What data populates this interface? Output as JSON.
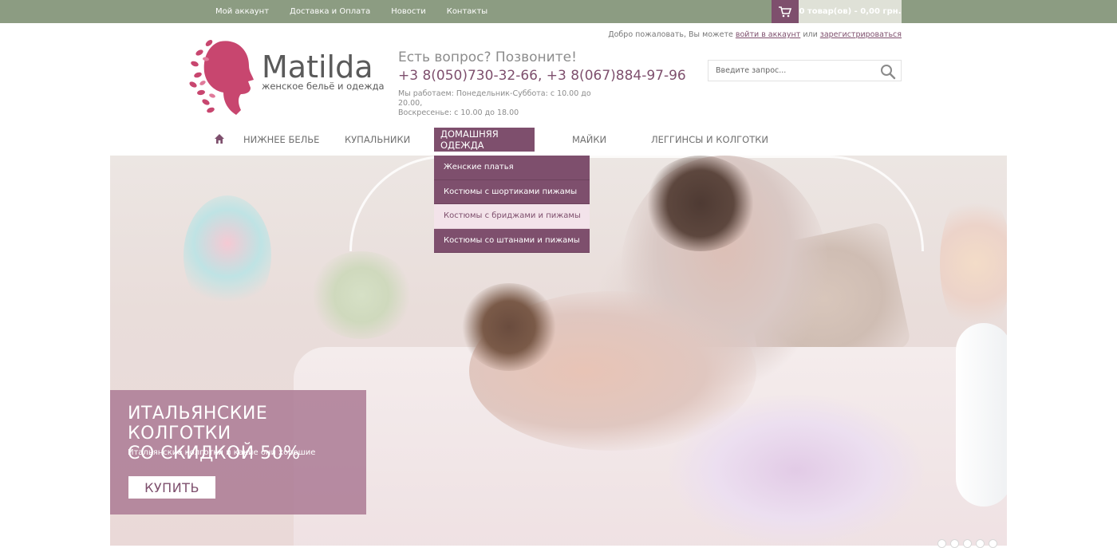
{
  "topbar": {
    "links": [
      "Мой аккаунт",
      "Доставка и Оплата",
      "Новости",
      "Контакты"
    ],
    "cart_text": "0 товар(ов) - 0,00 грн.",
    "cart_icon": "cart-icon"
  },
  "header": {
    "welcome_prefix": "Добро пожаловать, Вы можете",
    "login_link": "войти в аккаунт",
    "or_text": "или",
    "register_link": "зарегистрироваться",
    "logo_title": "Matilda",
    "logo_subtitle": "женское бельё и одежда",
    "ask": "Есть вопрос? Позвоните!",
    "phones": "+3 8(050)730-32-66, +3 8(067)884-97-96",
    "hours_line1": "Мы работаем: Понедельник-Суббота: с 10.00 до 20.00,",
    "hours_line2": "Воскресенье: с 10.00 до 18.00",
    "search_placeholder": "Введите запрос..."
  },
  "nav": {
    "items": [
      "НИЖНЕЕ БЕЛЬЕ",
      "КУПАЛЬНИКИ",
      "ДОМАШНЯЯ ОДЕЖДА",
      "МАЙКИ",
      "ЛЕГГИНСЫ И КОЛГОТКИ"
    ],
    "active_item": "ДОМАШНЯЯ ОДЕЖДА",
    "dropdown": [
      "Женские платья",
      "Костюмы с шортиками пижамы",
      "Костюмы с бриджами и пижамы",
      "Костюмы со штанами и пижамы"
    ],
    "dropdown_hover": "Костюмы с бриджами и пижамы"
  },
  "slider": {
    "promo_title_line1": "ИТАЛЬЯНСКИЕ КОЛГОТКИ",
    "promo_title_line2": "СО СКИДКОЙ 50%",
    "promo_subtitle": "Итальянские колготки и какие они хорошие",
    "promo_button": "КУПИТЬ",
    "dots_count": 5
  },
  "colors": {
    "topbar": "#8c9c82",
    "accent": "#7e4f6d",
    "promo_bg": "#ac7a94",
    "dropdown_hover_bg": "#f3e3ea"
  }
}
